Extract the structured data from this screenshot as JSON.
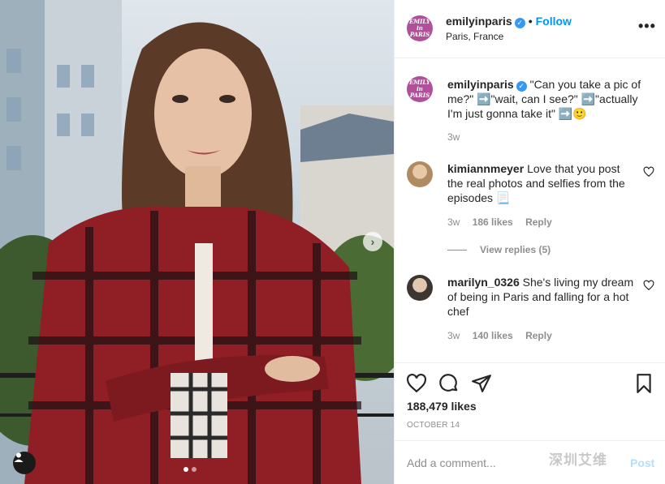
{
  "post": {
    "username": "emilyinparis",
    "follow_label": "Follow",
    "location": "Paris, France",
    "more_label": "•••",
    "avatar_text": "EMILY in PARIS"
  },
  "caption": {
    "username": "emilyinparis",
    "text": "\"Can you take a pic of me?\" ➡️\"wait, can I see?\" ➡️\"actually I'm just gonna take it\" ➡️🙂",
    "time": "3w"
  },
  "comments": [
    {
      "username": "kimiannmeyer",
      "text": "Love that you post the real photos and selfies from the episodes 📃",
      "time": "3w",
      "likes": "186 likes",
      "reply_label": "Reply"
    },
    {
      "username": "marilyn_0326",
      "text": "She's living my dream of being in Paris and falling for a hot chef",
      "time": "3w",
      "likes": "140 likes",
      "reply_label": "Reply"
    }
  ],
  "view_replies": "View replies (5)",
  "engagement": {
    "likes": "188,479 likes",
    "date": "OCTOBER 14"
  },
  "comment_input": {
    "placeholder": "Add a comment...",
    "post_label": "Post"
  },
  "watermark": "深圳艾维",
  "colors": {
    "link_blue": "#0095f6",
    "verified_blue": "#3897f0",
    "muted_text": "#8e8e8e",
    "brand_avatar": "#b04f9a"
  },
  "icons": {
    "verified": "verified-badge-icon",
    "like": "heart-icon",
    "comment": "comment-bubble-icon",
    "share": "paper-plane-icon",
    "save": "bookmark-icon",
    "tag": "user-tag-icon",
    "next": "chevron-right-icon"
  }
}
